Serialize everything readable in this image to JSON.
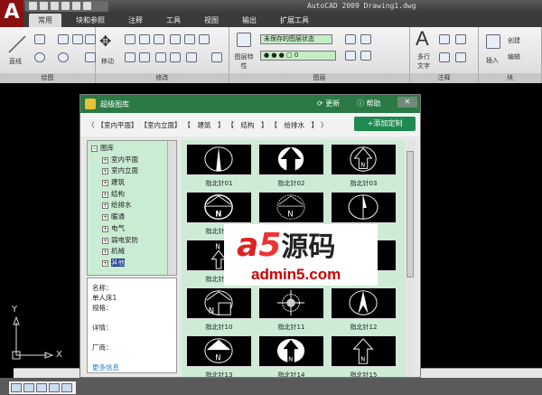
{
  "app": {
    "title": "AutoCAD 2009  Drawing1.dwg",
    "logo": "A"
  },
  "menu_tabs": [
    "常用",
    "块和参照",
    "注释",
    "工具",
    "视图",
    "输出",
    "扩展工具"
  ],
  "ribbon": {
    "panels": [
      {
        "label": "绘图",
        "items": [
          "直线"
        ]
      },
      {
        "label": "修改",
        "items": [
          "移动"
        ]
      },
      {
        "label": "图层",
        "items": [
          "图层特性"
        ],
        "layer_state": "未保存的图层状态",
        "current_layer": "0"
      },
      {
        "label": "注释",
        "items": [
          "多行文字"
        ]
      },
      {
        "label": "块",
        "items": [
          "插入",
          "创建",
          "编辑"
        ]
      }
    ]
  },
  "dialog": {
    "title": "超级图库",
    "refresh": "更新",
    "help": "帮助",
    "breadcrumb": [
      "〈",
      "【室内平面】",
      "【室内立面】",
      "【　建筑　】",
      "【　结构　】",
      "【　给排水　】",
      "〉"
    ],
    "add_button": "+添加定制",
    "tree": {
      "root": "图库",
      "items": [
        "室内平面",
        "室内立面",
        "建筑",
        "结构",
        "给排水",
        "暖通",
        "电气",
        "弱电安防",
        "机械",
        "其他"
      ],
      "selected": "其他"
    },
    "info": {
      "name_label": "名称：",
      "name_value": "单人床1",
      "spec_label": "规格：",
      "detail_label": "详情：",
      "vendor_label": "厂商：",
      "more_link": "更多信息"
    },
    "items": [
      "指北针01",
      "指北针02",
      "指北针03",
      "指北针04",
      "指北针05",
      "指北针06",
      "指北针07",
      "指北针08",
      "指北针09",
      "指北针10",
      "指北针11",
      "指北针12",
      "指北针13",
      "指北针14",
      "指北针15"
    ]
  },
  "watermark": {
    "brand": "a5源码",
    "url": "admin5.com"
  },
  "ucs": {
    "x": "X",
    "y": "Y"
  }
}
